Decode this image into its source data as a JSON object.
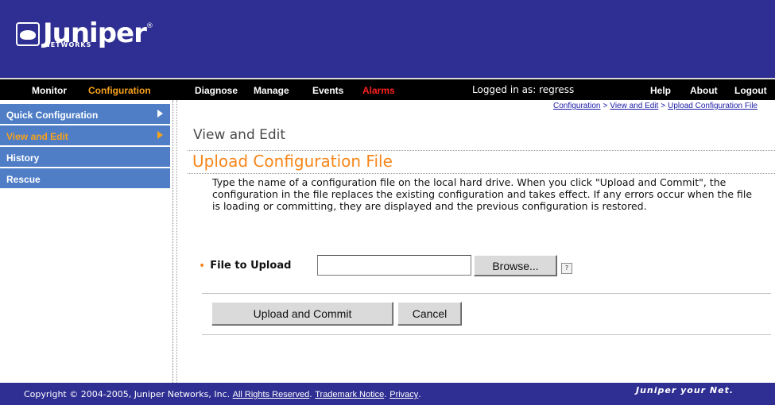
{
  "header": {
    "logo_text": "Juniper",
    "logo_reg": "®",
    "logo_sub": "NETWORKS"
  },
  "nav": {
    "monitor": "Monitor",
    "configuration": "Configuration",
    "diagnose": "Diagnose",
    "manage": "Manage",
    "events": "Events",
    "alarms": "Alarms",
    "logged_in": "Logged in as: regress",
    "help": "Help",
    "about": "About",
    "logout": "Logout"
  },
  "sidebar": {
    "items": [
      {
        "label": "Quick Configuration"
      },
      {
        "label": "View and Edit"
      },
      {
        "label": "History"
      },
      {
        "label": "Rescue"
      }
    ]
  },
  "breadcrumb": {
    "items": [
      "Configuration",
      "View and Edit",
      "Upload Configuration File"
    ],
    "separator": ">"
  },
  "main": {
    "heading": "View and Edit",
    "title": "Upload Configuration File",
    "description": "Type the name of a configuration file on the local hard drive. When you click \"Upload and Commit\", the configuration in the file replaces the existing configuration and takes effect. If any errors occur when the file is loading or committing, they are displayed and the previous configuration is restored.",
    "required_marker": "•",
    "file_label": "File to Upload",
    "file_value": "",
    "browse_label": "Browse...",
    "help_label": "?",
    "upload_label": "Upload and Commit",
    "cancel_label": "Cancel"
  },
  "footer": {
    "copyright": "Copyright © 2004-2005, Juniper Networks, Inc.",
    "rights": "All Rights Reserved",
    "trademark": "Trademark Notice",
    "privacy": "Privacy",
    "tagline": "Juniper your Net."
  },
  "colors": {
    "header_bg": "#2f2f93",
    "sidebar_bg": "#4f7ec7",
    "accent_orange": "#f7861b",
    "alarm_red": "#ff2020"
  }
}
